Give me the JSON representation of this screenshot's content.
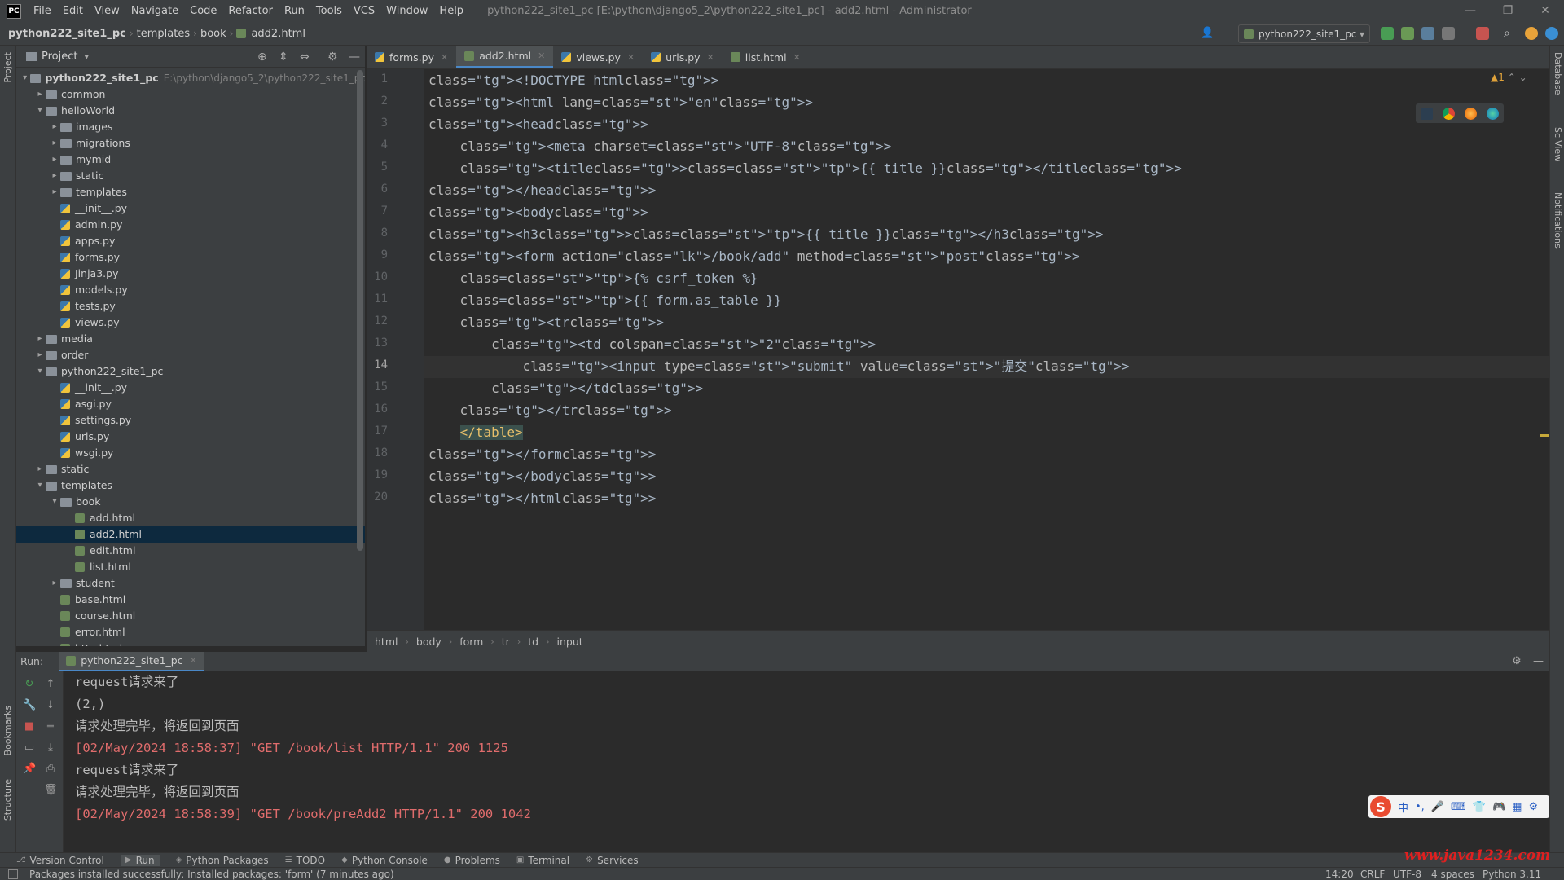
{
  "app": {
    "logo": "PC",
    "window_title": "python222_site1_pc [E:\\python\\django5_2\\python222_site1_pc] - add2.html - Administrator",
    "menu": [
      "File",
      "Edit",
      "View",
      "Navigate",
      "Code",
      "Refactor",
      "Run",
      "Tools",
      "VCS",
      "Window",
      "Help"
    ]
  },
  "nav": {
    "breadcrumb": [
      "python222_site1_pc",
      "templates",
      "book",
      "add2.html"
    ],
    "run_config": "python222_site1_pc"
  },
  "project": {
    "title": "Project",
    "root_name": "python222_site1_pc",
    "root_path": "E:\\python\\django5_2\\python222_site1_pc",
    "items": [
      {
        "label": "common",
        "type": "folder",
        "depth": 1,
        "open": false
      },
      {
        "label": "helloWorld",
        "type": "folder",
        "depth": 1,
        "open": true
      },
      {
        "label": "images",
        "type": "folder",
        "depth": 2,
        "open": false
      },
      {
        "label": "migrations",
        "type": "folder",
        "depth": 2,
        "open": false
      },
      {
        "label": "mymid",
        "type": "folder",
        "depth": 2,
        "open": false
      },
      {
        "label": "static",
        "type": "folder",
        "depth": 2,
        "open": false
      },
      {
        "label": "templates",
        "type": "folder",
        "depth": 2,
        "open": false
      },
      {
        "label": "__init__.py",
        "type": "py",
        "depth": 2
      },
      {
        "label": "admin.py",
        "type": "py",
        "depth": 2
      },
      {
        "label": "apps.py",
        "type": "py",
        "depth": 2
      },
      {
        "label": "forms.py",
        "type": "py",
        "depth": 2
      },
      {
        "label": "Jinja3.py",
        "type": "py",
        "depth": 2
      },
      {
        "label": "models.py",
        "type": "py",
        "depth": 2
      },
      {
        "label": "tests.py",
        "type": "py",
        "depth": 2
      },
      {
        "label": "views.py",
        "type": "py",
        "depth": 2
      },
      {
        "label": "media",
        "type": "folder",
        "depth": 1,
        "open": false
      },
      {
        "label": "order",
        "type": "folder",
        "depth": 1,
        "open": false
      },
      {
        "label": "python222_site1_pc",
        "type": "folder",
        "depth": 1,
        "open": true
      },
      {
        "label": "__init__.py",
        "type": "py",
        "depth": 2
      },
      {
        "label": "asgi.py",
        "type": "py",
        "depth": 2
      },
      {
        "label": "settings.py",
        "type": "py",
        "depth": 2
      },
      {
        "label": "urls.py",
        "type": "py",
        "depth": 2
      },
      {
        "label": "wsgi.py",
        "type": "py",
        "depth": 2
      },
      {
        "label": "static",
        "type": "folder",
        "depth": 1,
        "open": false
      },
      {
        "label": "templates",
        "type": "folder",
        "depth": 1,
        "open": true
      },
      {
        "label": "book",
        "type": "folder",
        "depth": 2,
        "open": true
      },
      {
        "label": "add.html",
        "type": "html",
        "depth": 3
      },
      {
        "label": "add2.html",
        "type": "html",
        "depth": 3,
        "selected": true
      },
      {
        "label": "edit.html",
        "type": "html",
        "depth": 3
      },
      {
        "label": "list.html",
        "type": "html",
        "depth": 3
      },
      {
        "label": "student",
        "type": "folder",
        "depth": 2,
        "open": false
      },
      {
        "label": "base.html",
        "type": "html",
        "depth": 2
      },
      {
        "label": "course.html",
        "type": "html",
        "depth": 2
      },
      {
        "label": "error.html",
        "type": "html",
        "depth": 2
      },
      {
        "label": "http.html",
        "type": "html",
        "depth": 2
      }
    ]
  },
  "tabs": [
    {
      "label": "forms.py",
      "type": "py",
      "active": false
    },
    {
      "label": "add2.html",
      "type": "html",
      "active": true
    },
    {
      "label": "views.py",
      "type": "py",
      "active": false
    },
    {
      "label": "urls.py",
      "type": "py",
      "active": false
    },
    {
      "label": "list.html",
      "type": "html",
      "active": false
    }
  ],
  "editor": {
    "warning_count": "1",
    "current_line": 14,
    "lines": [
      "<!DOCTYPE html>",
      "<html lang=\"en\">",
      "<head>",
      "    <meta charset=\"UTF-8\">",
      "    <title>{{ title }}</title>",
      "</head>",
      "<body>",
      "<h3>{{ title }}</h3>",
      "<form action=\"/book/add\" method=\"post\">",
      "    {% csrf_token %}",
      "    {{ form.as_table }}",
      "    <tr>",
      "        <td colspan=\"2\">",
      "            <input type=\"submit\" value=\"提交\">",
      "        </td>",
      "    </tr>",
      "    </table>",
      "</form>",
      "</body>",
      "</html>"
    ]
  },
  "breadcrumbs": [
    "html",
    "body",
    "form",
    "tr",
    "td",
    "input"
  ],
  "run": {
    "label": "Run:",
    "tab": "python222_site1_pc",
    "output": [
      {
        "text": "request请求来了",
        "kind": "normal"
      },
      {
        "text": "(2,)",
        "kind": "normal"
      },
      {
        "text": "请求处理完毕，将返回到页面",
        "kind": "normal"
      },
      {
        "text": "[02/May/2024 18:58:37] \"GET /book/list HTTP/1.1\" 200 1125",
        "kind": "err"
      },
      {
        "text": "request请求来了",
        "kind": "normal"
      },
      {
        "text": "请求处理完毕，将返回到页面",
        "kind": "normal"
      },
      {
        "text": "[02/May/2024 18:58:39] \"GET /book/preAdd2 HTTP/1.1\" 200 1042",
        "kind": "err"
      }
    ]
  },
  "tool_windows": [
    "Version Control",
    "Run",
    "Python Packages",
    "TODO",
    "Python Console",
    "Problems",
    "Terminal",
    "Services"
  ],
  "status": {
    "message": "Packages installed successfully: Installed packages: 'form' (7 minutes ago)",
    "position": "14:20",
    "line_sep": "CRLF",
    "encoding": "UTF-8",
    "indent": "4 spaces",
    "interpreter": "Python 3.11"
  },
  "side_labels": {
    "project": "Project",
    "bookmarks": "Bookmarks",
    "structure": "Structure",
    "database": "Database",
    "sciview": "SciView",
    "notifications": "Notifications"
  },
  "ime": {
    "logo": "S",
    "lang": "中"
  },
  "watermark": "www.java1234.com"
}
